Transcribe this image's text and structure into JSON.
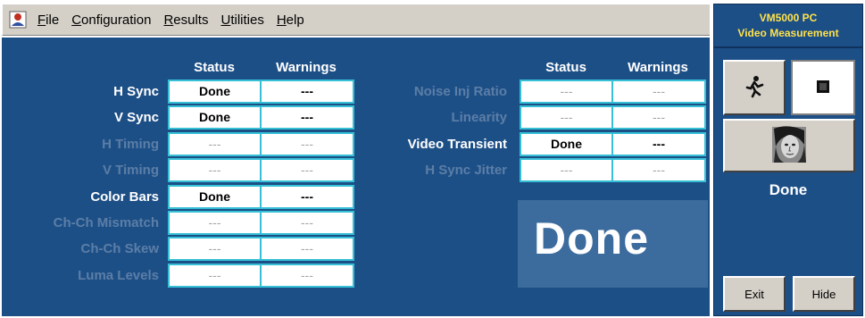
{
  "menu": {
    "items": [
      {
        "mnemonic": "F",
        "rest": "ile"
      },
      {
        "mnemonic": "C",
        "rest": "onfiguration"
      },
      {
        "mnemonic": "R",
        "rest": "esults"
      },
      {
        "mnemonic": "U",
        "rest": "tilities"
      },
      {
        "mnemonic": "H",
        "rest": "elp"
      }
    ]
  },
  "icons": {
    "app": "app-logo-icon",
    "run": "running-man-icon",
    "stop": "stop-icon",
    "picture": "face-picture-icon"
  },
  "left_table": {
    "headers": {
      "status": "Status",
      "warnings": "Warnings"
    },
    "rows": [
      {
        "label": "H Sync",
        "status": "Done",
        "warnings": "---",
        "active": true
      },
      {
        "label": "V Sync",
        "status": "Done",
        "warnings": "---",
        "active": true
      },
      {
        "label": "H Timing",
        "status": "---",
        "warnings": "---",
        "active": false
      },
      {
        "label": "V Timing",
        "status": "---",
        "warnings": "---",
        "active": false
      },
      {
        "label": "Color Bars",
        "status": "Done",
        "warnings": "---",
        "active": true
      },
      {
        "label": "Ch-Ch Mismatch",
        "status": "---",
        "warnings": "---",
        "active": false
      },
      {
        "label": "Ch-Ch Skew",
        "status": "---",
        "warnings": "---",
        "active": false
      },
      {
        "label": "Luma Levels",
        "status": "---",
        "warnings": "---",
        "active": false
      }
    ]
  },
  "right_table": {
    "headers": {
      "status": "Status",
      "warnings": "Warnings"
    },
    "rows": [
      {
        "label": "Noise Inj Ratio",
        "status": "---",
        "warnings": "---",
        "active": false
      },
      {
        "label": "Linearity",
        "status": "---",
        "warnings": "---",
        "active": false
      },
      {
        "label": "Video Transient",
        "status": "Done",
        "warnings": "---",
        "active": true
      },
      {
        "label": "H Sync Jitter",
        "status": "---",
        "warnings": "---",
        "active": false
      }
    ]
  },
  "big_status": "Done",
  "side": {
    "title_line1": "VM5000 PC",
    "title_line2": "Video Measurement",
    "status": "Done",
    "exit_label": "Exit",
    "hide_label": "Hide"
  },
  "colors": {
    "panel": "#1d4f87",
    "cell_border": "#35c0d6",
    "title_text": "#ffe24a",
    "inactive_label": "#5b7ea6"
  }
}
